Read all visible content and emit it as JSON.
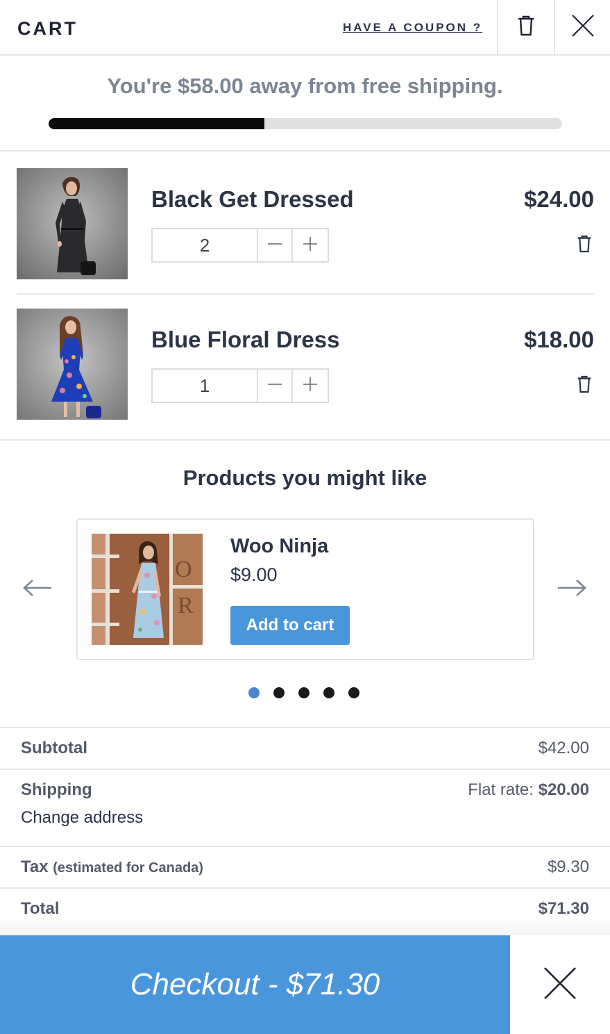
{
  "header": {
    "title": "CART",
    "coupon_link": "HAVE A COUPON ?",
    "trash_icon": "trash-icon",
    "close_icon": "close-icon"
  },
  "shipping_notice": {
    "message": "You're $58.00 away from free shipping.",
    "progress_fraction": 0.42
  },
  "cart_items": [
    {
      "name": "Black Get Dressed",
      "price": "$24.00",
      "quantity": "2",
      "image": "woman-black-dress"
    },
    {
      "name": "Blue Floral Dress",
      "price": "$18.00",
      "quantity": "1",
      "image": "woman-blue-floral-dress"
    }
  ],
  "recommendations": {
    "title": "Products you might like",
    "product": {
      "name": "Woo Ninja",
      "price": "$9.00",
      "button": "Add to cart",
      "image": "woman-floral-dress-bookshelf"
    },
    "slides": 5,
    "active_slide": 1
  },
  "totals": {
    "subtotal_label": "Subtotal",
    "subtotal_value": "$42.00",
    "shipping_label": "Shipping",
    "shipping_prefix": "Flat rate: ",
    "shipping_value": "$20.00",
    "change_address": "Change address",
    "tax_label": "Tax",
    "tax_note": "(estimated for Canada)",
    "tax_value": "$9.30",
    "total_label": "Total",
    "total_value": "$71.30"
  },
  "footer": {
    "checkout_label": "Checkout - $71.30"
  },
  "colors": {
    "accent": "#4a96da",
    "progress_fill": "#0a0a0a",
    "progress_track": "#e0e0e0",
    "text_dark": "#2c3446",
    "text_muted": "#7c8591",
    "active_dot": "#4a86c8"
  }
}
